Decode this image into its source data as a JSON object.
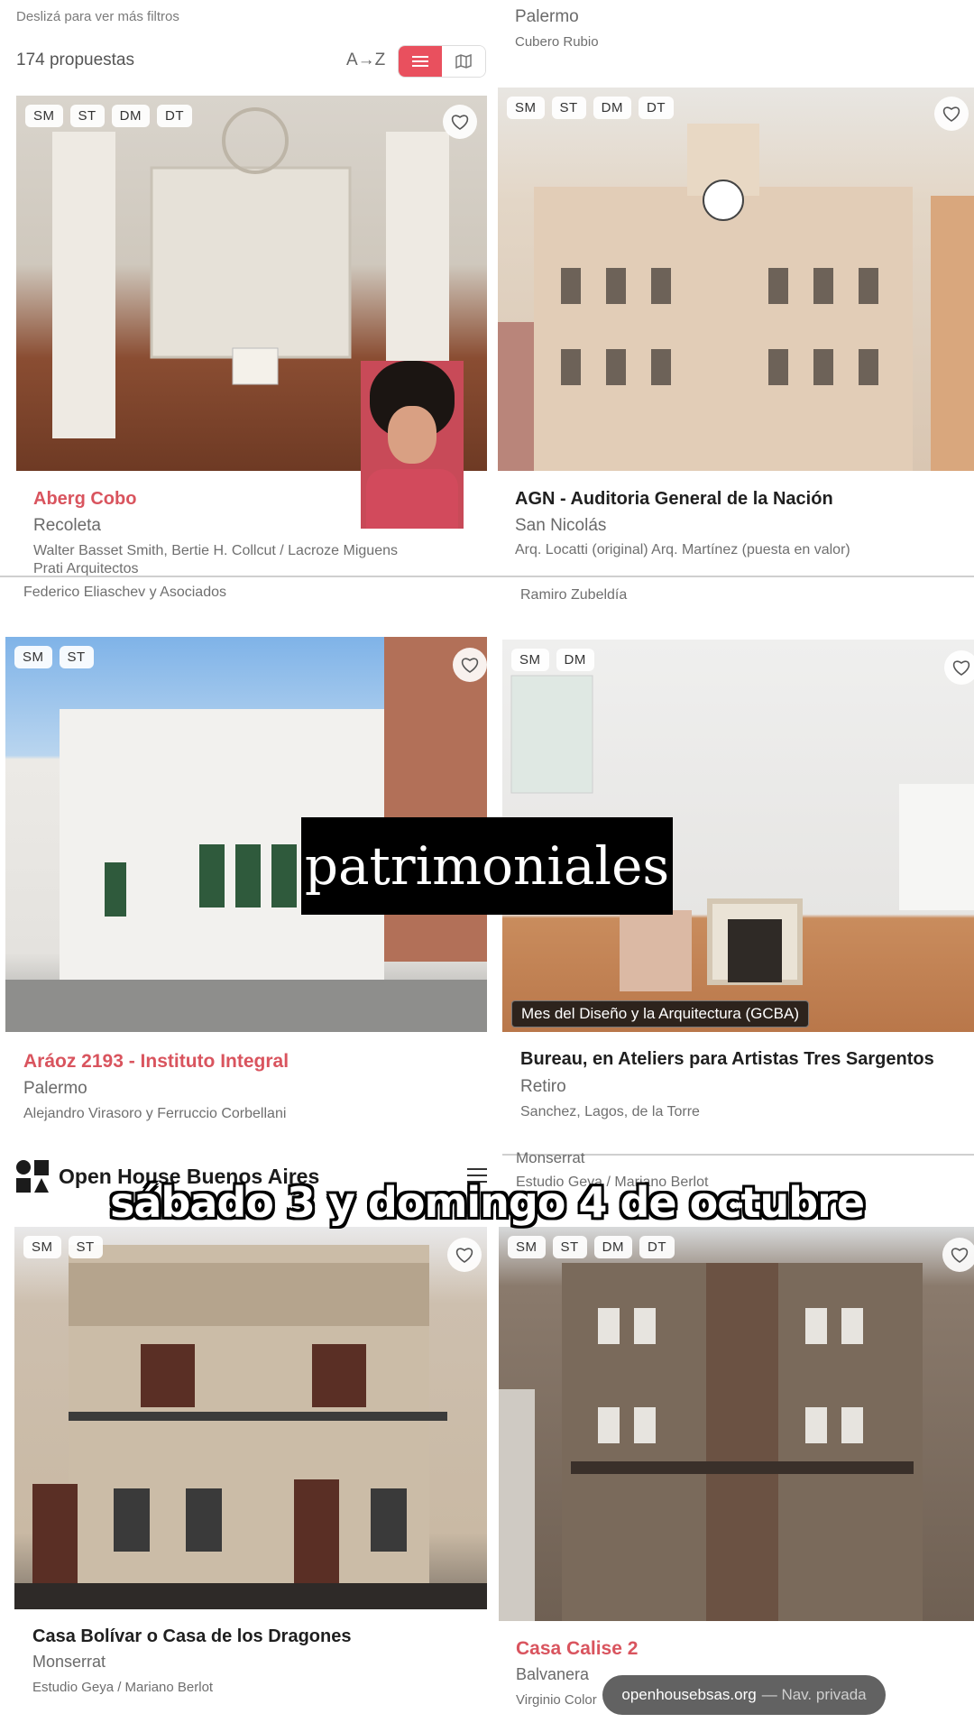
{
  "top": {
    "hint": "Deslizá para ver más filtros",
    "count": "174 propuestas",
    "sort": "A→Z",
    "right_location": "Palermo",
    "right_author": "Cubero Rubio"
  },
  "cards": [
    {
      "tags": [
        "SM",
        "ST",
        "DM",
        "DT"
      ],
      "title": "Aberg Cobo",
      "location": "Recoleta",
      "authors": "Walter Basset Smith, Bertie H. Collcut / Lacroze Miguens Prati Arquitectos"
    },
    {
      "tags": [
        "SM",
        "ST",
        "DM",
        "DT"
      ],
      "title": "AGN - Auditoria General de la Nación",
      "location": "San Nicolás",
      "authors": "Arq. Locatti (original) Arq. Martínez (puesta en valor)"
    },
    {
      "tags": [
        "SM",
        "ST"
      ],
      "title": "Aráoz 2193 - Instituto Integral",
      "location": "Palermo",
      "authors": "Alejandro Virasoro y Ferruccio Corbellani"
    },
    {
      "tags": [
        "SM",
        "DM"
      ],
      "title": "Bureau, en Ateliers para Artistas Tres Sargentos",
      "location": "Retiro",
      "authors": "Sanchez, Lagos, de la Torre",
      "badge": "Mes del Diseño y la Arquitectura (GCBA)"
    },
    {
      "tags": [
        "SM",
        "ST"
      ],
      "title": "Casa Bolívar o Casa de los Dragones",
      "location": "Monserrat",
      "authors": "Estudio Geya / Mariano Berlot"
    },
    {
      "tags": [
        "SM",
        "ST",
        "DM",
        "DT"
      ],
      "title": "Casa Calise 2",
      "location": "Balvanera",
      "authors": "Virginio Color"
    }
  ],
  "between": {
    "left_author": "Federico Eliaschev y Asociados",
    "right_author": "Ramiro Zubeldía",
    "right_location2": "Monserrat",
    "right_author2": "Estudio Geya / Mariano Berlot"
  },
  "brand": {
    "name": "Open House Buenos Aires",
    "logo": "OH BA"
  },
  "overlays": {
    "word": "patrimoniales",
    "caption": "sábado 3 y domingo 4 de octubre",
    "url": "openhousebsas.org",
    "url_tail": "— Nav. privada"
  },
  "colors": {
    "accent": "#e9505e",
    "title_red": "#d9545e"
  }
}
